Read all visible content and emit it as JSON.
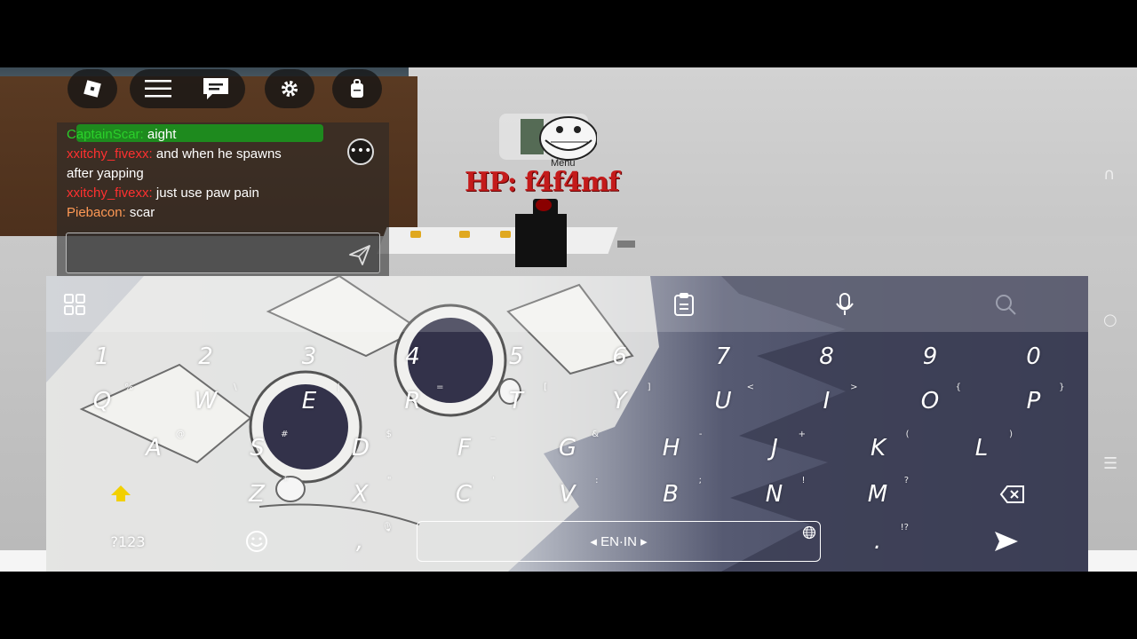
{
  "game": {
    "nametag": "HP: f4f4mf",
    "menu_label": "Menu"
  },
  "topbar": {
    "roblox_icon": "roblox-logo-icon",
    "menu_icon": "hamburger-icon",
    "chat_icon": "chat-icon",
    "settings_icon": "gear-icon",
    "backpack_icon": "backpack-icon"
  },
  "chat": {
    "messages": [
      {
        "user": "CaptainScar:",
        "text": "aight"
      },
      {
        "user": "xxitchy_fivexx:",
        "text": "and when he spawns"
      },
      {
        "user": "",
        "text": "after yapping"
      },
      {
        "user": "xxitchy_fivexx:",
        "text": "just use paw pain"
      },
      {
        "user": "Piebacon:",
        "text": "scar"
      }
    ],
    "input_placeholder": "",
    "colors": {
      "green": "#2ad12a",
      "red": "#ff3030",
      "orange": "#ff9955"
    }
  },
  "keyboard": {
    "toolbar": [
      "apps-grid-icon",
      "clipboard-icon",
      "microphone-icon",
      "search-icon"
    ],
    "row_numbers": [
      "1",
      "2",
      "3",
      "4",
      "5",
      "6",
      "7",
      "8",
      "9",
      "0"
    ],
    "row_q": [
      {
        "k": "Q",
        "h": "%"
      },
      {
        "k": "W",
        "h": "\\"
      },
      {
        "k": "E",
        "h": "|"
      },
      {
        "k": "R",
        "h": "="
      },
      {
        "k": "T",
        "h": "["
      },
      {
        "k": "Y",
        "h": "]"
      },
      {
        "k": "U",
        "h": "<"
      },
      {
        "k": "I",
        "h": ">"
      },
      {
        "k": "O",
        "h": "{"
      },
      {
        "k": "P",
        "h": "}"
      }
    ],
    "row_a": [
      {
        "k": "A",
        "h": "@"
      },
      {
        "k": "S",
        "h": "#"
      },
      {
        "k": "D",
        "h": "$"
      },
      {
        "k": "F",
        "h": "_"
      },
      {
        "k": "G",
        "h": "&"
      },
      {
        "k": "H",
        "h": "-"
      },
      {
        "k": "J",
        "h": "+"
      },
      {
        "k": "K",
        "h": "("
      },
      {
        "k": "L",
        "h": ")"
      }
    ],
    "row_z": [
      {
        "k": "Z",
        "h": "*"
      },
      {
        "k": "X",
        "h": "\""
      },
      {
        "k": "C",
        "h": "'"
      },
      {
        "k": "V",
        "h": ":"
      },
      {
        "k": "B",
        "h": ";"
      },
      {
        "k": "N",
        "h": "!"
      },
      {
        "k": "M",
        "h": "?"
      }
    ],
    "symbols_key": "?123",
    "comma_key": ",",
    "space_label": "EN·IN",
    "period_key": ".",
    "period_hint": "!?",
    "shift_color": "#f2d000"
  }
}
